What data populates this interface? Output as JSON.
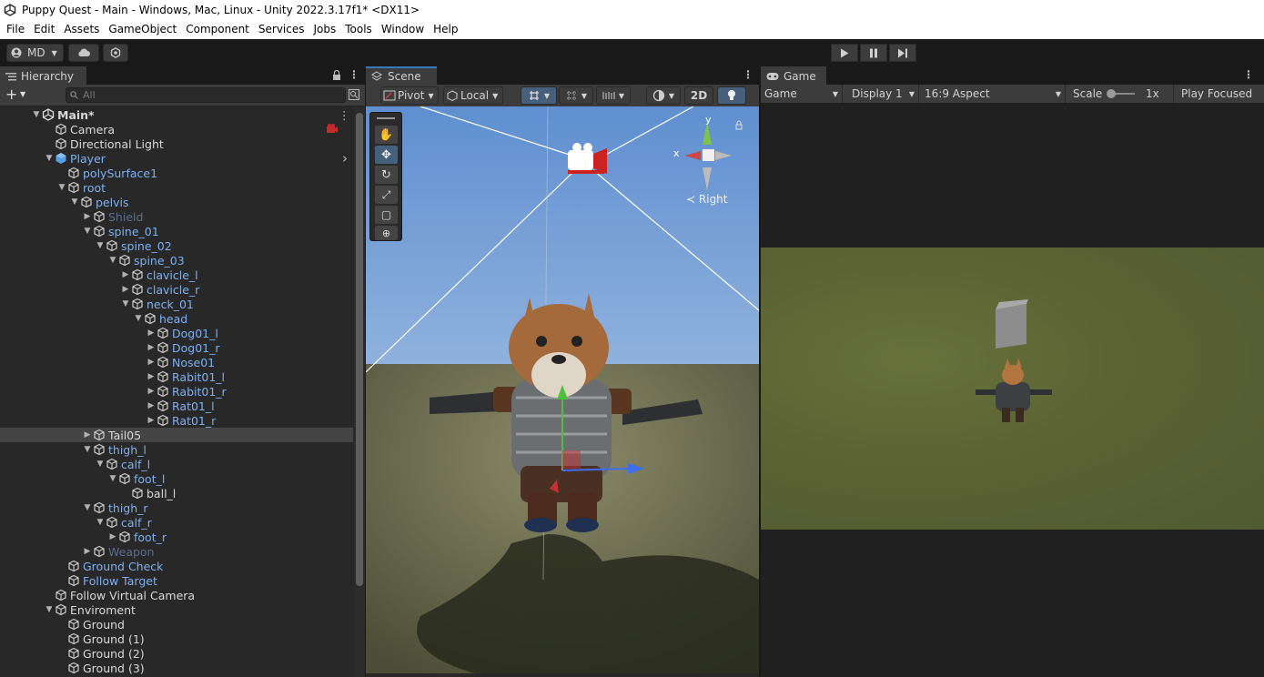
{
  "window": {
    "title": "Puppy Quest - Main - Windows, Mac, Linux - Unity 2022.3.17f1* <DX11>"
  },
  "menu": [
    "File",
    "Edit",
    "Assets",
    "GameObject",
    "Component",
    "Services",
    "Jobs",
    "Tools",
    "Window",
    "Help"
  ],
  "toolbar": {
    "account_label": "MD"
  },
  "hierarchy": {
    "tab_label": "Hierarchy",
    "search_placeholder": "All",
    "rows": [
      {
        "label": "Main*",
        "depth": 0,
        "icon": "scene-icon",
        "arrow": "open",
        "color": "white"
      },
      {
        "label": "Camera",
        "depth": 1,
        "icon": "cube-outline-icon",
        "arrow": "none",
        "color": "white"
      },
      {
        "label": "Directional Light",
        "depth": 1,
        "icon": "cube-outline-icon",
        "arrow": "none",
        "color": "white"
      },
      {
        "label": "Player",
        "depth": 1,
        "icon": "cube-prefab-icon",
        "arrow": "open",
        "color": "blue"
      },
      {
        "label": "polySurface1",
        "depth": 2,
        "icon": "cube-outline-icon",
        "arrow": "none",
        "color": "blue"
      },
      {
        "label": "root",
        "depth": 2,
        "icon": "cube-outline-icon",
        "arrow": "open",
        "color": "blue"
      },
      {
        "label": "pelvis",
        "depth": 3,
        "icon": "cube-outline-icon",
        "arrow": "open",
        "color": "blue"
      },
      {
        "label": "Shield",
        "depth": 4,
        "icon": "cube-outline-icon",
        "arrow": "closed",
        "color": "dim"
      },
      {
        "label": "spine_01",
        "depth": 4,
        "icon": "cube-outline-icon",
        "arrow": "open",
        "color": "blue"
      },
      {
        "label": "spine_02",
        "depth": 5,
        "icon": "cube-outline-icon",
        "arrow": "open",
        "color": "blue"
      },
      {
        "label": "spine_03",
        "depth": 6,
        "icon": "cube-outline-icon",
        "arrow": "open",
        "color": "blue"
      },
      {
        "label": "clavicle_l",
        "depth": 7,
        "icon": "cube-outline-icon",
        "arrow": "closed",
        "color": "blue"
      },
      {
        "label": "clavicle_r",
        "depth": 7,
        "icon": "cube-outline-icon",
        "arrow": "closed",
        "color": "blue"
      },
      {
        "label": "neck_01",
        "depth": 7,
        "icon": "cube-outline-icon",
        "arrow": "open",
        "color": "blue"
      },
      {
        "label": "head",
        "depth": 8,
        "icon": "cube-outline-icon",
        "arrow": "open",
        "color": "blue"
      },
      {
        "label": "Dog01_l",
        "depth": 9,
        "icon": "cube-outline-icon",
        "arrow": "closed",
        "color": "blue"
      },
      {
        "label": "Dog01_r",
        "depth": 9,
        "icon": "cube-outline-icon",
        "arrow": "closed",
        "color": "blue"
      },
      {
        "label": "Nose01",
        "depth": 9,
        "icon": "cube-outline-icon",
        "arrow": "closed",
        "color": "blue"
      },
      {
        "label": "Rabit01_l",
        "depth": 9,
        "icon": "cube-outline-icon",
        "arrow": "closed",
        "color": "blue"
      },
      {
        "label": "Rabit01_r",
        "depth": 9,
        "icon": "cube-outline-icon",
        "arrow": "closed",
        "color": "blue"
      },
      {
        "label": "Rat01_l",
        "depth": 9,
        "icon": "cube-outline-icon",
        "arrow": "closed",
        "color": "blue"
      },
      {
        "label": "Rat01_r",
        "depth": 9,
        "icon": "cube-outline-icon",
        "arrow": "closed",
        "color": "blue"
      },
      {
        "label": "Tail05",
        "depth": 4,
        "icon": "cube-outline-icon",
        "arrow": "closed",
        "color": "white",
        "selected": true
      },
      {
        "label": "thigh_l",
        "depth": 4,
        "icon": "cube-outline-icon",
        "arrow": "open",
        "color": "blue"
      },
      {
        "label": "calf_l",
        "depth": 5,
        "icon": "cube-outline-icon",
        "arrow": "open",
        "color": "blue"
      },
      {
        "label": "foot_l",
        "depth": 6,
        "icon": "cube-outline-icon",
        "arrow": "open",
        "color": "blue"
      },
      {
        "label": "ball_l",
        "depth": 7,
        "icon": "cube-outline-icon",
        "arrow": "none",
        "color": "white"
      },
      {
        "label": "thigh_r",
        "depth": 4,
        "icon": "cube-outline-icon",
        "arrow": "open",
        "color": "blue"
      },
      {
        "label": "calf_r",
        "depth": 5,
        "icon": "cube-outline-icon",
        "arrow": "open",
        "color": "blue"
      },
      {
        "label": "foot_r",
        "depth": 6,
        "icon": "cube-outline-icon",
        "arrow": "closed",
        "color": "blue"
      },
      {
        "label": "Weapon",
        "depth": 4,
        "icon": "cube-outline-icon",
        "arrow": "closed",
        "color": "dim"
      },
      {
        "label": "Ground Check",
        "depth": 2,
        "icon": "cube-outline-icon",
        "arrow": "none",
        "color": "blue"
      },
      {
        "label": "Follow Target",
        "depth": 2,
        "icon": "cube-outline-icon",
        "arrow": "none",
        "color": "blue"
      },
      {
        "label": "Follow Virtual Camera",
        "depth": 1,
        "icon": "cube-outline-icon",
        "arrow": "none",
        "color": "white"
      },
      {
        "label": "Enviroment",
        "depth": 1,
        "icon": "cube-outline-icon",
        "arrow": "open",
        "color": "white"
      },
      {
        "label": "Ground",
        "depth": 2,
        "icon": "cube-outline-icon",
        "arrow": "none",
        "color": "white"
      },
      {
        "label": "Ground (1)",
        "depth": 2,
        "icon": "cube-outline-icon",
        "arrow": "none",
        "color": "white"
      },
      {
        "label": "Ground (2)",
        "depth": 2,
        "icon": "cube-outline-icon",
        "arrow": "none",
        "color": "white"
      },
      {
        "label": "Ground (3)",
        "depth": 2,
        "icon": "cube-outline-icon",
        "arrow": "none",
        "color": "white"
      }
    ]
  },
  "scene": {
    "tab_label": "Scene",
    "pivot_label": "Pivot",
    "local_label": "Local",
    "mode_2d_label": "2D",
    "gizmo": {
      "y_label": "y",
      "x_label": "x",
      "view_label": "Right"
    }
  },
  "game": {
    "tab_label": "Game",
    "mode_label": "Game",
    "display_label": "Display 1",
    "aspect_label": "16:9 Aspect",
    "scale_label": "Scale",
    "scale_value": "1x",
    "play_focused_label": "Play Focused"
  },
  "colors": {
    "accent": "#3a79bb",
    "panel": "#282828",
    "toolbar": "#3c3c3c",
    "prefab_blue": "#7cb0f0"
  }
}
